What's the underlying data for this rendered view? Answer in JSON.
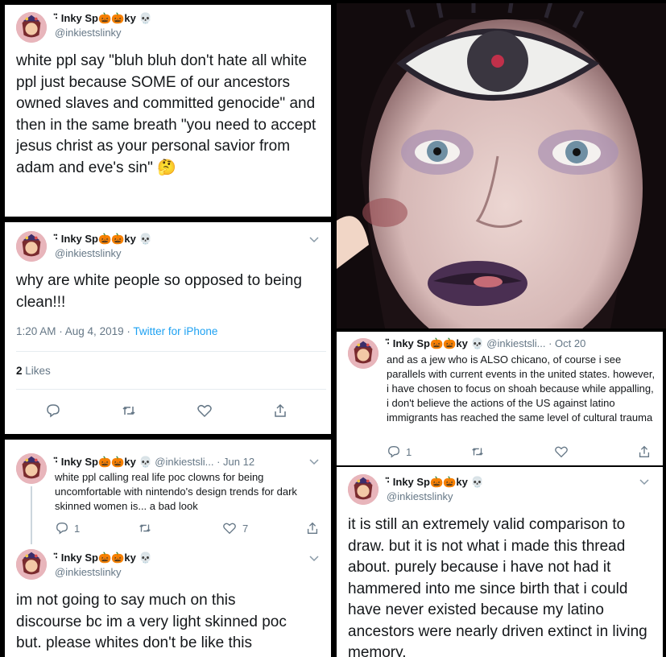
{
  "user": {
    "display_name": "Inky Sp🎃🎃ky",
    "name_prefix": "⋅̈",
    "name_suffix": "💀",
    "handle": "@inkiestslinky",
    "handle_truncated": "@inkiestsli..."
  },
  "tweet1": {
    "text": "white ppl say \"bluh bluh don't hate all white ppl just because SOME of our ancestors owned slaves and committed genocide\" and then in the same breath \"you need to accept jesus christ as your personal savior from adam and eve's sin\"",
    "emoji": "🤔"
  },
  "tweet2": {
    "text": "why are white people so opposed to being clean!!!",
    "time": "1:20 AM · Aug 4, 2019 · ",
    "source": "Twitter for iPhone",
    "likes_count": "2",
    "likes_label": " Likes"
  },
  "tweet3": {
    "date": "· Jun 12",
    "text": "white ppl calling real life poc clowns for being uncomfortable with nintendo's design trends for dark skinned women is... a bad look",
    "replies": "1",
    "likes": "7"
  },
  "tweet4": {
    "text": "im not going to say much on this discourse bc im a very light skinned poc but. please whites don't be like this"
  },
  "tweet5": {
    "date": "· Oct 20",
    "text": "and as a jew who is ALSO chicano, of course i see parallels with current events in the united states. however, i have chosen to focus on shoah because while appalling, i don't believe the actions of the US against latino immigrants has reached the same level of cultural trauma",
    "replies": "1"
  },
  "tweet6": {
    "text": "it is still an extremely valid comparison to draw. but it is not what i made this thread about. purely because i have not had it hammered into me since birth that i could have never existed because my latino ancestors were nearly driven extinct in living memory."
  },
  "colors": {
    "link": "#1da1f2",
    "muted": "#657786",
    "divider": "#e6ecf0",
    "border": "#000000"
  }
}
